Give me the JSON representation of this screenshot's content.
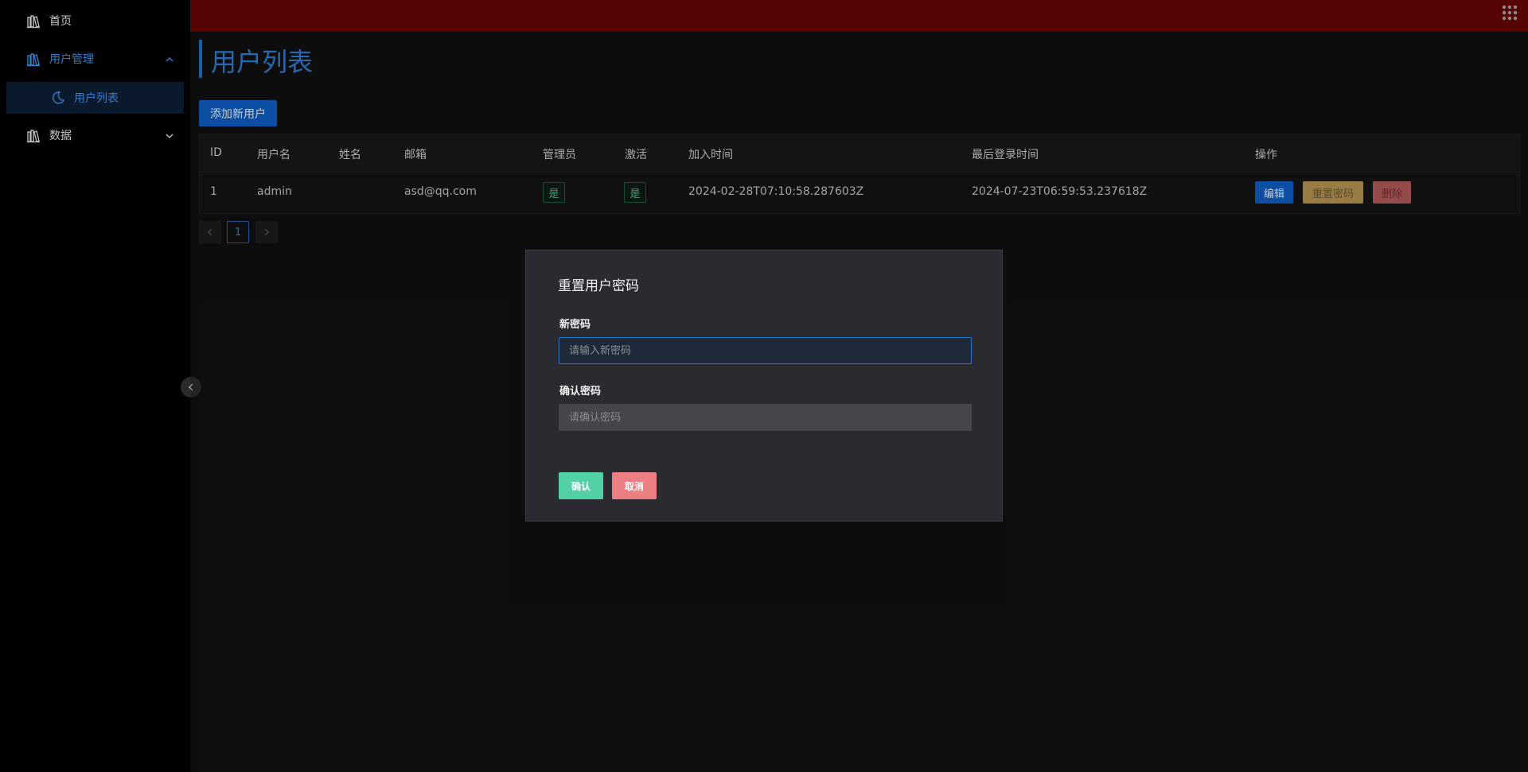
{
  "sidebar": {
    "items": [
      {
        "label": "首页",
        "icon": "library-icon"
      },
      {
        "label": "用户管理",
        "icon": "library-icon",
        "expanded": true,
        "children": [
          {
            "label": "用户列表",
            "icon": "moon-icon"
          }
        ]
      },
      {
        "label": "数据",
        "icon": "library-icon",
        "expanded": false
      }
    ]
  },
  "header": {
    "apps_icon": "grid-icon",
    "bg_color": "#560304"
  },
  "page": {
    "title": "用户列表",
    "add_button": "添加新用户"
  },
  "table": {
    "columns": [
      "ID",
      "用户名",
      "姓名",
      "邮箱",
      "管理员",
      "激活",
      "加入时间",
      "最后登录时间",
      "操作"
    ],
    "rows": [
      {
        "id": "1",
        "username": "admin",
        "name": "",
        "email": "asd@qq.com",
        "admin": "是",
        "active": "是",
        "joined": "2024-02-28T07:10:58.287603Z",
        "last_login": "2024-07-23T06:59:53.237618Z",
        "actions": [
          "编辑",
          "重置密码",
          "删除"
        ]
      }
    ]
  },
  "pagination": {
    "current": "1",
    "prev_icon": "chevron-left-icon",
    "next_icon": "chevron-right-icon"
  },
  "modal": {
    "title": "重置用户密码",
    "new_password_label": "新密码",
    "new_password_placeholder": "请输入新密码",
    "new_password_value": "",
    "confirm_password_label": "确认密码",
    "confirm_password_placeholder": "请确认密码",
    "confirm_password_value": "",
    "ok": "确认",
    "cancel": "取消"
  },
  "colors": {
    "accent": "#2d7bd0",
    "primary_button": "#0f5cc0",
    "ok_button": "#53d1a6",
    "cancel_button": "#ec7e84",
    "warning_button": "#b49150",
    "danger_button": "#b0585a"
  }
}
